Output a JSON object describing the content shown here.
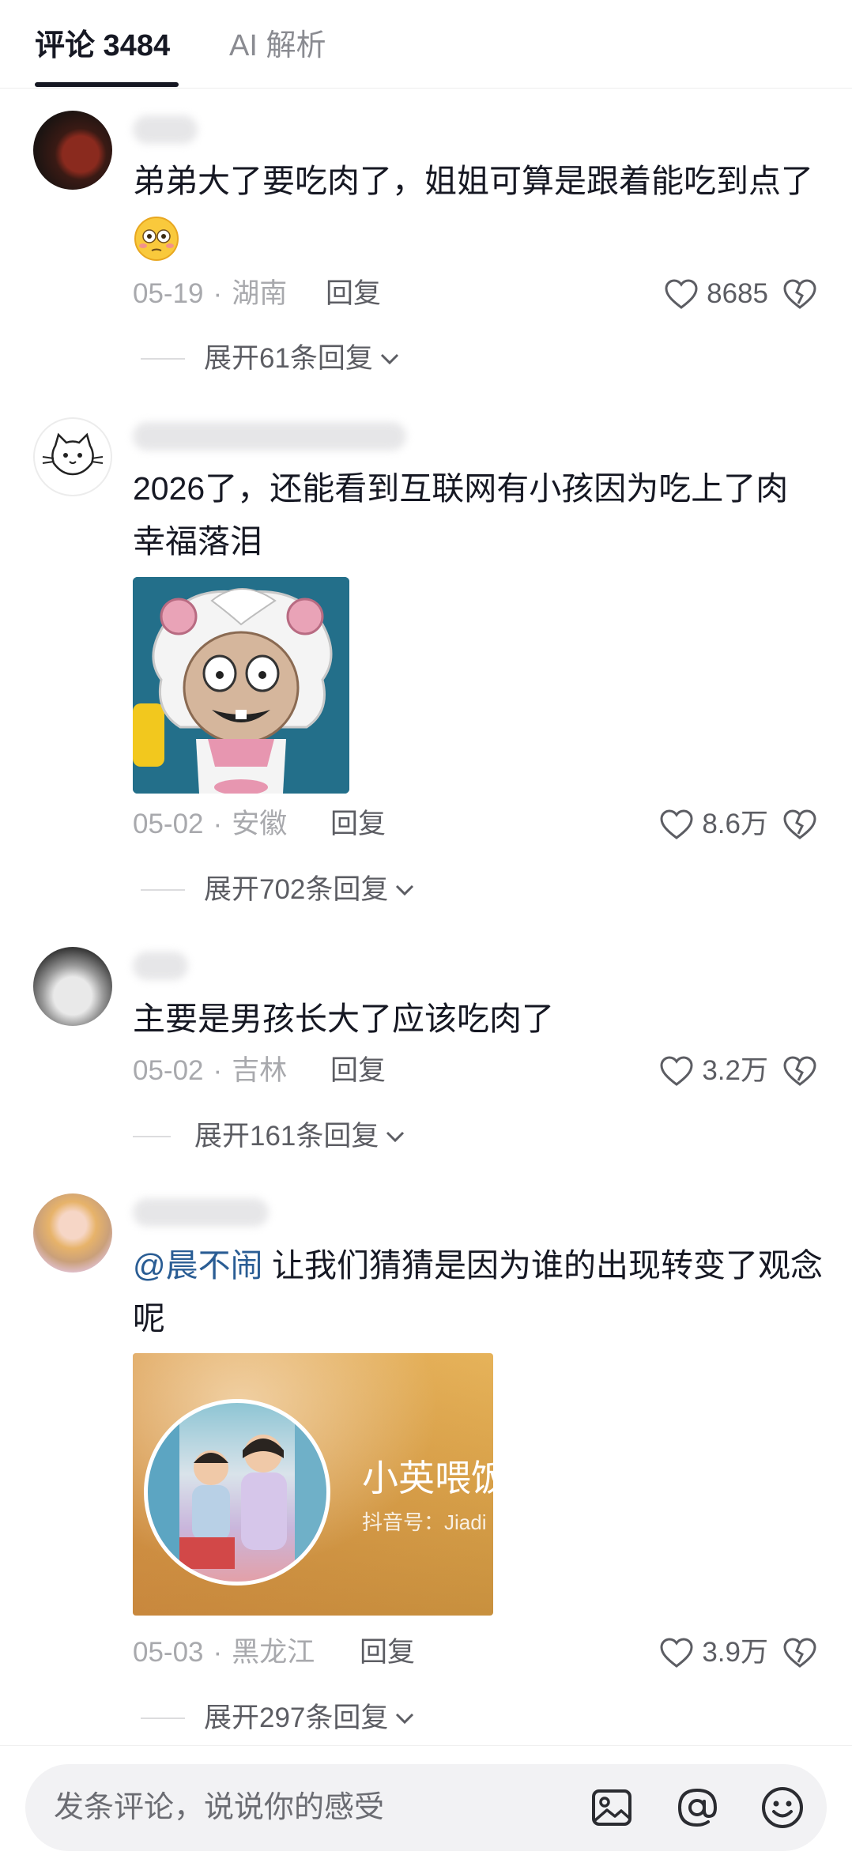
{
  "tabs": {
    "comments_label": "评论 3484",
    "ai_label": "AI 解析"
  },
  "comments": [
    {
      "text": "弟弟大了要吃肉了，姐姐可算是跟着能吃到点了",
      "emoji": "😳",
      "date": "05-19",
      "location": "湖南",
      "reply_label": "回复",
      "likes": "8685",
      "expand_label": "展开61条回复"
    },
    {
      "text": "2026了，还能看到互联网有小孩因为吃上了肉幸福落泪",
      "date": "05-02",
      "location": "安徽",
      "reply_label": "回复",
      "likes": "8.6万",
      "expand_label": "展开702条回复"
    },
    {
      "text": "主要是男孩长大了应该吃肉了",
      "date": "05-02",
      "location": "吉林",
      "reply_label": "回复",
      "likes": "3.2万",
      "expand_label": "展开161条回复"
    },
    {
      "mention": "@晨不闹",
      "text": " 让我们猜猜是因为谁的出现转变了观念呢",
      "card_name": "小英喂饭",
      "card_id": "抖音号：Jiadi",
      "date": "05-03",
      "location": "黑龙江",
      "reply_label": "回复",
      "likes": "3.9万",
      "expand_label": "展开297条回复"
    }
  ],
  "input": {
    "placeholder": "发条评论，说说你的感受"
  },
  "icons": {
    "like": "heart-icon",
    "dislike": "broken-heart-icon",
    "expand": "chevron-down-icon",
    "image": "image-icon",
    "mention": "at-icon",
    "emoji": "emoji-icon"
  },
  "colors": {
    "mention": "#2a5d94",
    "text": "#161823",
    "meta": "#a8a9ad"
  }
}
